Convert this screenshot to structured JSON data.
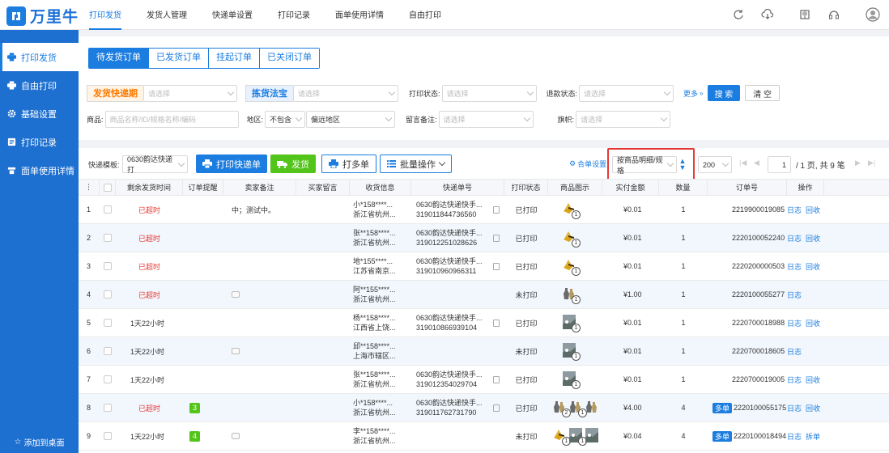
{
  "brand": {
    "logo_mark": "卐",
    "name": "万里牛",
    "color": "#1b7de0"
  },
  "topnav": [
    "打印发货",
    "发货人管理",
    "快递单设置",
    "打印记录",
    "面单使用详情",
    "自由打印"
  ],
  "topnav_active": 0,
  "top_icons": [
    "refresh-icon",
    "cloud-download-icon",
    "book-icon",
    "headset-icon",
    "user-icon"
  ],
  "sidebar": {
    "items": [
      {
        "label": "打印发货",
        "icon": "printer-icon"
      },
      {
        "label": "自由打印",
        "icon": "printer-icon"
      },
      {
        "label": "基础设置",
        "icon": "gear-icon"
      },
      {
        "label": "打印记录",
        "icon": "record-icon"
      },
      {
        "label": "面单使用详情",
        "icon": "sheet-icon"
      }
    ],
    "active": 0,
    "bottom": "添加到桌面"
  },
  "order_tabs": [
    "待发货订单",
    "已发货订单",
    "挂起订单",
    "已关闭订单"
  ],
  "filters": {
    "ship_deadline": {
      "tag": "发货快递期",
      "placeholder": "请选择"
    },
    "pick_method": {
      "tag": "拣货法宝",
      "placeholder": "请选择"
    },
    "print_status": {
      "label": "打印状态:",
      "placeholder": "请选择"
    },
    "refund_status": {
      "label": "退款状态:",
      "placeholder": "请选择"
    },
    "more": "更多",
    "search": "搜 索",
    "clear": "清 空",
    "goods": {
      "label": "商品:",
      "placeholder": "商品名称/ID/规格名称/编码"
    },
    "region": {
      "label": "地区:",
      "mode": "不包含",
      "value": "偏远地区"
    },
    "remark": {
      "label": "留言备注:",
      "placeholder": "请选择"
    },
    "flag": {
      "label": "旗帜:",
      "placeholder": "请选择"
    }
  },
  "toolbar": {
    "template_label": "快递模板:",
    "template_value": "0630韵达快递打",
    "print_waybill": "打印快递单",
    "ship": "发货",
    "print_multi": "打多单",
    "batch": "批量操作",
    "merge_settings": "合单设置",
    "sort_value": "按商品明细/规格",
    "page_size": "200",
    "page_current": "1",
    "page_total_text": "/ 1 页, 共 9 笔"
  },
  "columns": [
    "⋮",
    "",
    "剩余发货时间",
    "订单提醒",
    "卖家备注",
    "买家留言",
    "收货信息",
    "快递单号",
    "打印状态",
    "商品图示",
    "实付金额",
    "数量",
    "订单号",
    "操作"
  ],
  "rows": [
    {
      "no": "1",
      "remain": "已超时",
      "remain_red": true,
      "remind": "",
      "memo": "中；测试中。",
      "memo_icon": false,
      "recv1": "小*158****...",
      "recv2": "浙江省杭州...",
      "exp1": "0630韵达快递快手...",
      "exp2": "319011844736560",
      "status": "已打印",
      "goods": [
        {
          "img": "gold",
          "n": "1"
        }
      ],
      "amount": "¥0.01",
      "qty": "1",
      "order": "2219900019085",
      "ops": [
        "日志",
        "回收"
      ],
      "multi": false
    },
    {
      "no": "2",
      "remain": "已超时",
      "remain_red": true,
      "remind": "",
      "memo": "",
      "memo_icon": false,
      "recv1": "张**158****...",
      "recv2": "浙江省杭州...",
      "exp1": "0630韵达快递快手...",
      "exp2": "319012251028626",
      "status": "已打印",
      "goods": [
        {
          "img": "gold",
          "n": "1"
        }
      ],
      "amount": "¥0.01",
      "qty": "1",
      "order": "2220100052240",
      "ops": [
        "日志",
        "回收"
      ],
      "multi": false
    },
    {
      "no": "3",
      "remain": "已超时",
      "remain_red": true,
      "remind": "",
      "memo": "",
      "memo_icon": false,
      "recv1": "地*155****...",
      "recv2": "江苏省南京...",
      "exp1": "0630韵达快递快手...",
      "exp2": "319010960966311",
      "status": "已打印",
      "goods": [
        {
          "img": "gold",
          "n": "1"
        }
      ],
      "amount": "¥0.01",
      "qty": "1",
      "order": "2220200000503",
      "ops": [
        "日志",
        "回收"
      ],
      "multi": false
    },
    {
      "no": "4",
      "remain": "已超时",
      "remain_red": true,
      "remind": "",
      "memo": "",
      "memo_icon": true,
      "recv1": "阿**155****...",
      "recv2": "浙江省杭州...",
      "exp1": "",
      "exp2": "",
      "status": "未打印",
      "goods": [
        {
          "img": "vase",
          "n": "1"
        }
      ],
      "amount": "¥1.00",
      "qty": "1",
      "order": "2220100055277",
      "ops": [
        "日志"
      ],
      "multi": false
    },
    {
      "no": "5",
      "remain": "1天22小时",
      "remain_red": false,
      "remind": "",
      "memo": "",
      "memo_icon": false,
      "recv1": "杨**158****...",
      "recv2": "江西省上饶...",
      "exp1": "0630韵达快递快手...",
      "exp2": "319010866939104",
      "status": "已打印",
      "goods": [
        {
          "img": "photo",
          "n": "1"
        }
      ],
      "amount": "¥0.01",
      "qty": "1",
      "order": "2220700018988",
      "ops": [
        "日志",
        "回收"
      ],
      "multi": false
    },
    {
      "no": "6",
      "remain": "1天22小时",
      "remain_red": false,
      "remind": "",
      "memo": "",
      "memo_icon": true,
      "recv1": "邱**158****...",
      "recv2": "上海市辖区...",
      "exp1": "",
      "exp2": "",
      "status": "未打印",
      "goods": [
        {
          "img": "photo",
          "n": "1"
        }
      ],
      "amount": "¥0.01",
      "qty": "1",
      "order": "2220700018605",
      "ops": [
        "日志"
      ],
      "multi": false
    },
    {
      "no": "7",
      "remain": "1天22小时",
      "remain_red": false,
      "remind": "",
      "memo": "",
      "memo_icon": false,
      "recv1": "张**158****...",
      "recv2": "浙江省杭州...",
      "exp1": "0630韵达快递快手...",
      "exp2": "319012354029704",
      "status": "已打印",
      "goods": [
        {
          "img": "photo",
          "n": "1"
        }
      ],
      "amount": "¥0.01",
      "qty": "1",
      "order": "2220700019005",
      "ops": [
        "日志",
        "回收"
      ],
      "multi": false
    },
    {
      "no": "8",
      "remain": "已超时",
      "remain_red": true,
      "remind": "3",
      "memo": "",
      "memo_icon": false,
      "recv1": "小*158****...",
      "recv2": "浙江省杭州...",
      "exp1": "0630韵达快递快手...",
      "exp2": "319011762731790",
      "status": "已打印",
      "goods": [
        {
          "img": "vase",
          "n": "2"
        },
        {
          "img": "vase",
          "n": "1"
        },
        {
          "img": "vase",
          "n": ""
        }
      ],
      "amount": "¥4.00",
      "qty": "4",
      "order": "2220100055175",
      "ops": [
        "日志",
        "回收"
      ],
      "multi": true,
      "multi_label": "多单"
    },
    {
      "no": "9",
      "remain": "1天22小时",
      "remain_red": false,
      "remind": "4",
      "memo": "",
      "memo_icon": true,
      "recv1": "李**158****...",
      "recv2": "浙江省杭州...",
      "exp1": "",
      "exp2": "",
      "status": "未打印",
      "goods": [
        {
          "img": "gold",
          "n": "1"
        },
        {
          "img": "photo",
          "n": "1"
        },
        {
          "img": "photo",
          "n": ""
        }
      ],
      "amount": "¥0.04",
      "qty": "4",
      "order": "2220100018494",
      "ops": [
        "日志",
        "拆单"
      ],
      "multi": true,
      "multi_label": "多单"
    }
  ],
  "colors": {
    "primary": "#1b7de0",
    "sidebar": "#1d6fd0",
    "overdue": "#e53935",
    "ship_green": "#52c41a",
    "highlight_box": "#e53935"
  }
}
